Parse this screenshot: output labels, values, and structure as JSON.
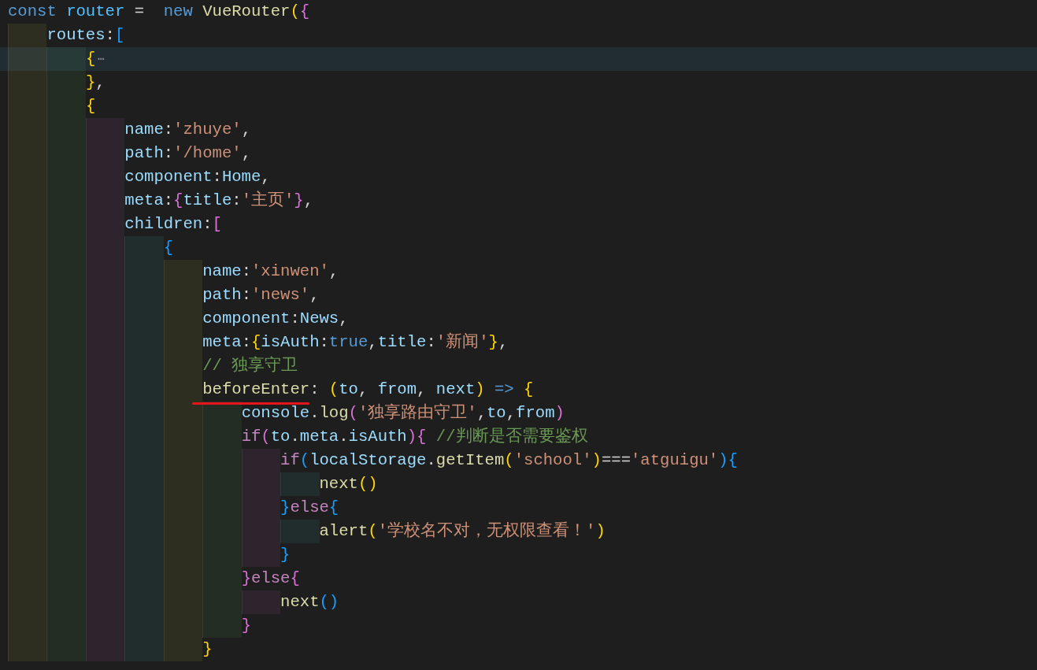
{
  "editor": {
    "lines": [
      {
        "current": false,
        "tokens": [
          {
            "text": "const ",
            "kind": "kw"
          },
          {
            "text": "router",
            "kind": "const"
          },
          {
            "text": " =  ",
            "kind": "punct"
          },
          {
            "text": "new ",
            "kind": "kw"
          },
          {
            "text": "VueRouter",
            "kind": "fn"
          },
          {
            "text": "(",
            "kind": "b1"
          },
          {
            "text": "{",
            "kind": "b2"
          }
        ]
      },
      {
        "current": false,
        "tokens": [
          {
            "kind": "indent"
          },
          {
            "text": "routes",
            "kind": "prop"
          },
          {
            "text": ":",
            "kind": "punct"
          },
          {
            "text": "[",
            "kind": "b3"
          }
        ]
      },
      {
        "current": true,
        "tokens": [
          {
            "kind": "indent"
          },
          {
            "kind": "indent"
          },
          {
            "text": "{",
            "kind": "b1"
          },
          {
            "text": "⋯",
            "kind": "fold"
          }
        ]
      },
      {
        "current": false,
        "tokens": [
          {
            "kind": "indent"
          },
          {
            "kind": "indent"
          },
          {
            "text": "}",
            "kind": "b1"
          },
          {
            "text": ",",
            "kind": "punct"
          }
        ]
      },
      {
        "current": false,
        "tokens": [
          {
            "kind": "indent"
          },
          {
            "kind": "indent"
          },
          {
            "text": "{",
            "kind": "b1"
          }
        ]
      },
      {
        "current": false,
        "tokens": [
          {
            "kind": "indent"
          },
          {
            "kind": "indent"
          },
          {
            "kind": "indent"
          },
          {
            "text": "name",
            "kind": "prop"
          },
          {
            "text": ":",
            "kind": "punct"
          },
          {
            "text": "'zhuye'",
            "kind": "str"
          },
          {
            "text": ",",
            "kind": "punct"
          }
        ]
      },
      {
        "current": false,
        "tokens": [
          {
            "kind": "indent"
          },
          {
            "kind": "indent"
          },
          {
            "kind": "indent"
          },
          {
            "text": "path",
            "kind": "prop"
          },
          {
            "text": ":",
            "kind": "punct"
          },
          {
            "text": "'/home'",
            "kind": "str"
          },
          {
            "text": ",",
            "kind": "punct"
          }
        ]
      },
      {
        "current": false,
        "tokens": [
          {
            "kind": "indent"
          },
          {
            "kind": "indent"
          },
          {
            "kind": "indent"
          },
          {
            "text": "component",
            "kind": "prop"
          },
          {
            "text": ":",
            "kind": "punct"
          },
          {
            "text": "Home",
            "kind": "prop"
          },
          {
            "text": ",",
            "kind": "punct"
          }
        ]
      },
      {
        "current": false,
        "tokens": [
          {
            "kind": "indent"
          },
          {
            "kind": "indent"
          },
          {
            "kind": "indent"
          },
          {
            "text": "meta",
            "kind": "prop"
          },
          {
            "text": ":",
            "kind": "punct"
          },
          {
            "text": "{",
            "kind": "b2"
          },
          {
            "text": "title",
            "kind": "prop"
          },
          {
            "text": ":",
            "kind": "punct"
          },
          {
            "text": "'主页'",
            "kind": "str"
          },
          {
            "text": "}",
            "kind": "b2"
          },
          {
            "text": ",",
            "kind": "punct"
          }
        ]
      },
      {
        "current": false,
        "tokens": [
          {
            "kind": "indent"
          },
          {
            "kind": "indent"
          },
          {
            "kind": "indent"
          },
          {
            "text": "children",
            "kind": "prop"
          },
          {
            "text": ":",
            "kind": "punct"
          },
          {
            "text": "[",
            "kind": "b2"
          }
        ]
      },
      {
        "current": false,
        "tokens": [
          {
            "kind": "indent"
          },
          {
            "kind": "indent"
          },
          {
            "kind": "indent"
          },
          {
            "kind": "indent"
          },
          {
            "text": "{",
            "kind": "b3"
          }
        ]
      },
      {
        "current": false,
        "tokens": [
          {
            "kind": "indent"
          },
          {
            "kind": "indent"
          },
          {
            "kind": "indent"
          },
          {
            "kind": "indent"
          },
          {
            "kind": "indent"
          },
          {
            "text": "name",
            "kind": "prop"
          },
          {
            "text": ":",
            "kind": "punct"
          },
          {
            "text": "'xinwen'",
            "kind": "str"
          },
          {
            "text": ",",
            "kind": "punct"
          }
        ]
      },
      {
        "current": false,
        "tokens": [
          {
            "kind": "indent"
          },
          {
            "kind": "indent"
          },
          {
            "kind": "indent"
          },
          {
            "kind": "indent"
          },
          {
            "kind": "indent"
          },
          {
            "text": "path",
            "kind": "prop"
          },
          {
            "text": ":",
            "kind": "punct"
          },
          {
            "text": "'news'",
            "kind": "str"
          },
          {
            "text": ",",
            "kind": "punct"
          }
        ]
      },
      {
        "current": false,
        "tokens": [
          {
            "kind": "indent"
          },
          {
            "kind": "indent"
          },
          {
            "kind": "indent"
          },
          {
            "kind": "indent"
          },
          {
            "kind": "indent"
          },
          {
            "text": "component",
            "kind": "prop"
          },
          {
            "text": ":",
            "kind": "punct"
          },
          {
            "text": "News",
            "kind": "prop"
          },
          {
            "text": ",",
            "kind": "punct"
          }
        ]
      },
      {
        "current": false,
        "tokens": [
          {
            "kind": "indent"
          },
          {
            "kind": "indent"
          },
          {
            "kind": "indent"
          },
          {
            "kind": "indent"
          },
          {
            "kind": "indent"
          },
          {
            "text": "meta",
            "kind": "prop"
          },
          {
            "text": ":",
            "kind": "punct"
          },
          {
            "text": "{",
            "kind": "b1"
          },
          {
            "text": "isAuth",
            "kind": "prop"
          },
          {
            "text": ":",
            "kind": "punct"
          },
          {
            "text": "true",
            "kind": "kw"
          },
          {
            "text": ",",
            "kind": "punct"
          },
          {
            "text": "title",
            "kind": "prop"
          },
          {
            "text": ":",
            "kind": "punct"
          },
          {
            "text": "'新闻'",
            "kind": "str"
          },
          {
            "text": "}",
            "kind": "b1"
          },
          {
            "text": ",",
            "kind": "punct"
          }
        ]
      },
      {
        "current": false,
        "tokens": [
          {
            "kind": "indent"
          },
          {
            "kind": "indent"
          },
          {
            "kind": "indent"
          },
          {
            "kind": "indent"
          },
          {
            "kind": "indent"
          },
          {
            "text": "// 独享守卫",
            "kind": "comment"
          }
        ]
      },
      {
        "current": false,
        "tokens": [
          {
            "kind": "indent"
          },
          {
            "kind": "indent"
          },
          {
            "kind": "indent"
          },
          {
            "kind": "indent"
          },
          {
            "kind": "indent"
          },
          {
            "text": "beforeEnter",
            "kind": "fn",
            "underlined": true
          },
          {
            "text": ": ",
            "kind": "punct"
          },
          {
            "text": "(",
            "kind": "b1"
          },
          {
            "text": "to",
            "kind": "prop"
          },
          {
            "text": ", ",
            "kind": "punct"
          },
          {
            "text": "from",
            "kind": "prop"
          },
          {
            "text": ", ",
            "kind": "punct"
          },
          {
            "text": "next",
            "kind": "prop"
          },
          {
            "text": ")",
            "kind": "b1"
          },
          {
            "text": " => ",
            "kind": "kw"
          },
          {
            "text": "{",
            "kind": "b1"
          }
        ]
      },
      {
        "current": false,
        "tokens": [
          {
            "kind": "indent"
          },
          {
            "kind": "indent"
          },
          {
            "kind": "indent"
          },
          {
            "kind": "indent"
          },
          {
            "kind": "indent"
          },
          {
            "kind": "indent"
          },
          {
            "text": "console",
            "kind": "prop"
          },
          {
            "text": ".",
            "kind": "punct"
          },
          {
            "text": "log",
            "kind": "fn"
          },
          {
            "text": "(",
            "kind": "b2"
          },
          {
            "text": "'独享路由守卫'",
            "kind": "str"
          },
          {
            "text": ",",
            "kind": "punct"
          },
          {
            "text": "to",
            "kind": "prop"
          },
          {
            "text": ",",
            "kind": "punct"
          },
          {
            "text": "from",
            "kind": "prop"
          },
          {
            "text": ")",
            "kind": "b2"
          }
        ]
      },
      {
        "current": false,
        "tokens": [
          {
            "kind": "indent"
          },
          {
            "kind": "indent"
          },
          {
            "kind": "indent"
          },
          {
            "kind": "indent"
          },
          {
            "kind": "indent"
          },
          {
            "kind": "indent"
          },
          {
            "text": "if",
            "kind": "ctrl"
          },
          {
            "text": "(",
            "kind": "b2"
          },
          {
            "text": "to",
            "kind": "prop"
          },
          {
            "text": ".",
            "kind": "punct"
          },
          {
            "text": "meta",
            "kind": "prop"
          },
          {
            "text": ".",
            "kind": "punct"
          },
          {
            "text": "isAuth",
            "kind": "prop"
          },
          {
            "text": ")",
            "kind": "b2"
          },
          {
            "text": "{",
            "kind": "b2"
          },
          {
            "text": " //判断是否需要鉴权",
            "kind": "comment"
          }
        ]
      },
      {
        "current": false,
        "tokens": [
          {
            "kind": "indent"
          },
          {
            "kind": "indent"
          },
          {
            "kind": "indent"
          },
          {
            "kind": "indent"
          },
          {
            "kind": "indent"
          },
          {
            "kind": "indent"
          },
          {
            "kind": "indent"
          },
          {
            "text": "if",
            "kind": "ctrl"
          },
          {
            "text": "(",
            "kind": "b3"
          },
          {
            "text": "localStorage",
            "kind": "prop"
          },
          {
            "text": ".",
            "kind": "punct"
          },
          {
            "text": "getItem",
            "kind": "fn"
          },
          {
            "text": "(",
            "kind": "b1"
          },
          {
            "text": "'school'",
            "kind": "str"
          },
          {
            "text": ")",
            "kind": "b1"
          },
          {
            "text": "===",
            "kind": "punct"
          },
          {
            "text": "'atguigu'",
            "kind": "str"
          },
          {
            "text": ")",
            "kind": "b3"
          },
          {
            "text": "{",
            "kind": "b3"
          }
        ]
      },
      {
        "current": false,
        "tokens": [
          {
            "kind": "indent"
          },
          {
            "kind": "indent"
          },
          {
            "kind": "indent"
          },
          {
            "kind": "indent"
          },
          {
            "kind": "indent"
          },
          {
            "kind": "indent"
          },
          {
            "kind": "indent"
          },
          {
            "kind": "indent"
          },
          {
            "text": "next",
            "kind": "fn"
          },
          {
            "text": "(",
            "kind": "b1"
          },
          {
            "text": ")",
            "kind": "b1"
          }
        ]
      },
      {
        "current": false,
        "tokens": [
          {
            "kind": "indent"
          },
          {
            "kind": "indent"
          },
          {
            "kind": "indent"
          },
          {
            "kind": "indent"
          },
          {
            "kind": "indent"
          },
          {
            "kind": "indent"
          },
          {
            "kind": "indent"
          },
          {
            "text": "}",
            "kind": "b3"
          },
          {
            "text": "else",
            "kind": "ctrl"
          },
          {
            "text": "{",
            "kind": "b3"
          }
        ]
      },
      {
        "current": false,
        "tokens": [
          {
            "kind": "indent"
          },
          {
            "kind": "indent"
          },
          {
            "kind": "indent"
          },
          {
            "kind": "indent"
          },
          {
            "kind": "indent"
          },
          {
            "kind": "indent"
          },
          {
            "kind": "indent"
          },
          {
            "kind": "indent"
          },
          {
            "text": "alert",
            "kind": "fn"
          },
          {
            "text": "(",
            "kind": "b1"
          },
          {
            "text": "'学校名不对，无权限查看！'",
            "kind": "str"
          },
          {
            "text": ")",
            "kind": "b1"
          }
        ]
      },
      {
        "current": false,
        "tokens": [
          {
            "kind": "indent"
          },
          {
            "kind": "indent"
          },
          {
            "kind": "indent"
          },
          {
            "kind": "indent"
          },
          {
            "kind": "indent"
          },
          {
            "kind": "indent"
          },
          {
            "kind": "indent"
          },
          {
            "text": "}",
            "kind": "b3"
          }
        ]
      },
      {
        "current": false,
        "tokens": [
          {
            "kind": "indent"
          },
          {
            "kind": "indent"
          },
          {
            "kind": "indent"
          },
          {
            "kind": "indent"
          },
          {
            "kind": "indent"
          },
          {
            "kind": "indent"
          },
          {
            "text": "}",
            "kind": "b2"
          },
          {
            "text": "else",
            "kind": "ctrl"
          },
          {
            "text": "{",
            "kind": "b2"
          }
        ]
      },
      {
        "current": false,
        "tokens": [
          {
            "kind": "indent"
          },
          {
            "kind": "indent"
          },
          {
            "kind": "indent"
          },
          {
            "kind": "indent"
          },
          {
            "kind": "indent"
          },
          {
            "kind": "indent"
          },
          {
            "kind": "indent"
          },
          {
            "text": "next",
            "kind": "fn"
          },
          {
            "text": "(",
            "kind": "b3"
          },
          {
            "text": ")",
            "kind": "b3"
          }
        ]
      },
      {
        "current": false,
        "tokens": [
          {
            "kind": "indent"
          },
          {
            "kind": "indent"
          },
          {
            "kind": "indent"
          },
          {
            "kind": "indent"
          },
          {
            "kind": "indent"
          },
          {
            "kind": "indent"
          },
          {
            "text": "}",
            "kind": "b2"
          }
        ]
      },
      {
        "current": false,
        "tokens": [
          {
            "kind": "indent"
          },
          {
            "kind": "indent"
          },
          {
            "kind": "indent"
          },
          {
            "kind": "indent"
          },
          {
            "kind": "indent"
          },
          {
            "text": "}",
            "kind": "b1"
          }
        ]
      }
    ]
  }
}
